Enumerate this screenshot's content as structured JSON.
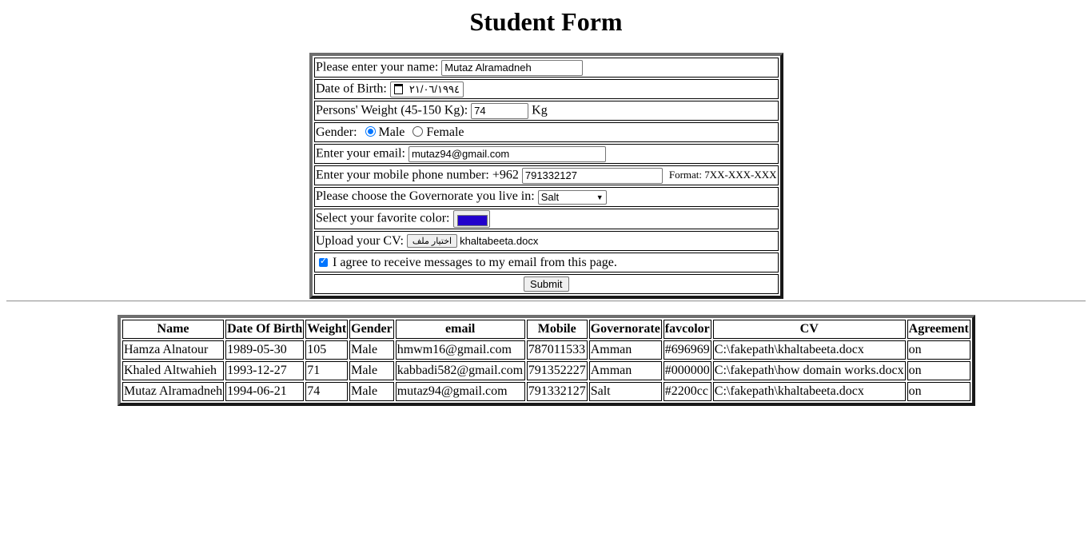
{
  "page": {
    "title": "Student Form"
  },
  "form": {
    "name_label": "Please enter your name:",
    "name_value": "Mutaz Alramadneh",
    "dob_label": "Date of Birth:",
    "dob_value": "٢١/٠٦/١٩٩٤",
    "weight_label": "Persons' Weight (45-150 Kg):",
    "weight_value": "74",
    "weight_unit": "Kg",
    "gender_label": "Gender:",
    "gender_male": "Male",
    "gender_female": "Female",
    "email_label": "Enter your email:",
    "email_value": "mutaz94@gmail.com",
    "phone_label": "Enter your mobile phone number: +962",
    "phone_value": "791332127",
    "phone_format": "Format: 7XX-XXX-XXX",
    "gov_label": "Please choose the Governorate you live in:",
    "gov_value": "Salt",
    "color_label": "Select your favorite color:",
    "color_value": "#2200cc",
    "cv_label": "Upload your CV:",
    "cv_button": "اختيار ملف",
    "cv_filename": "khaltabeeta.docx",
    "agree_label": "I agree to receive messages to my email from this page.",
    "submit_label": "Submit"
  },
  "table": {
    "headers": [
      "Name",
      "Date Of Birth",
      "Weight",
      "Gender",
      "email",
      "Mobile",
      "Governorate",
      "favcolor",
      "CV",
      "Agreement"
    ],
    "rows": [
      [
        "Hamza Alnatour",
        "1989-05-30",
        "105",
        "Male",
        "hmwm16@gmail.com",
        "787011533",
        "Amman",
        "#696969",
        "C:\\fakepath\\khaltabeeta.docx",
        "on"
      ],
      [
        "Khaled Altwahieh",
        "1993-12-27",
        "71",
        "Male",
        "kabbadi582@gmail.com",
        "791352227",
        "Amman",
        "#000000",
        "C:\\fakepath\\how domain works.docx",
        "on"
      ],
      [
        "Mutaz Alramadneh",
        "1994-06-21",
        "74",
        "Male",
        "mutaz94@gmail.com",
        "791332127",
        "Salt",
        "#2200cc",
        "C:\\fakepath\\khaltabeeta.docx",
        "on"
      ]
    ]
  }
}
